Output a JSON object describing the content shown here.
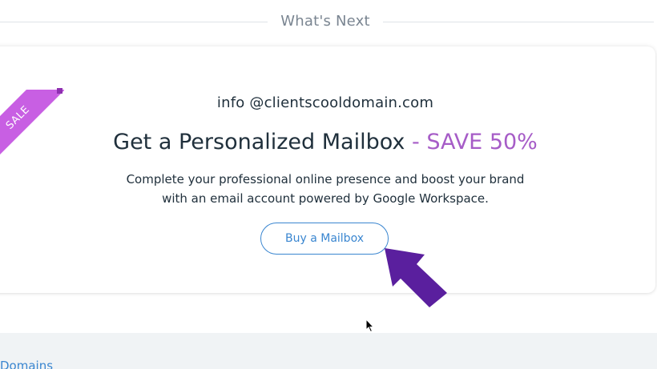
{
  "section": {
    "title": "What's Next"
  },
  "card": {
    "ribbon_label": "SALE",
    "email": "info @clientscooldomain.com",
    "headline": "Get a Personalized Mailbox",
    "headline_offer": "- SAVE 50%",
    "description_line1": "Complete your professional online presence and boost your brand",
    "description_line2": "with an email account powered by Google Workspace.",
    "cta_label": "Buy a Mailbox"
  },
  "footer": {
    "link_label": "Domains"
  },
  "colors": {
    "accent_purple": "#a65cc7",
    "ribbon": "#c85fe3",
    "link_blue": "#3a86d0",
    "arrow": "#5a1f9e",
    "text": "#20303c"
  },
  "icons": {
    "pointer_arrow": "purple-arrow-icon",
    "mouse_cursor": "cursor-icon"
  }
}
